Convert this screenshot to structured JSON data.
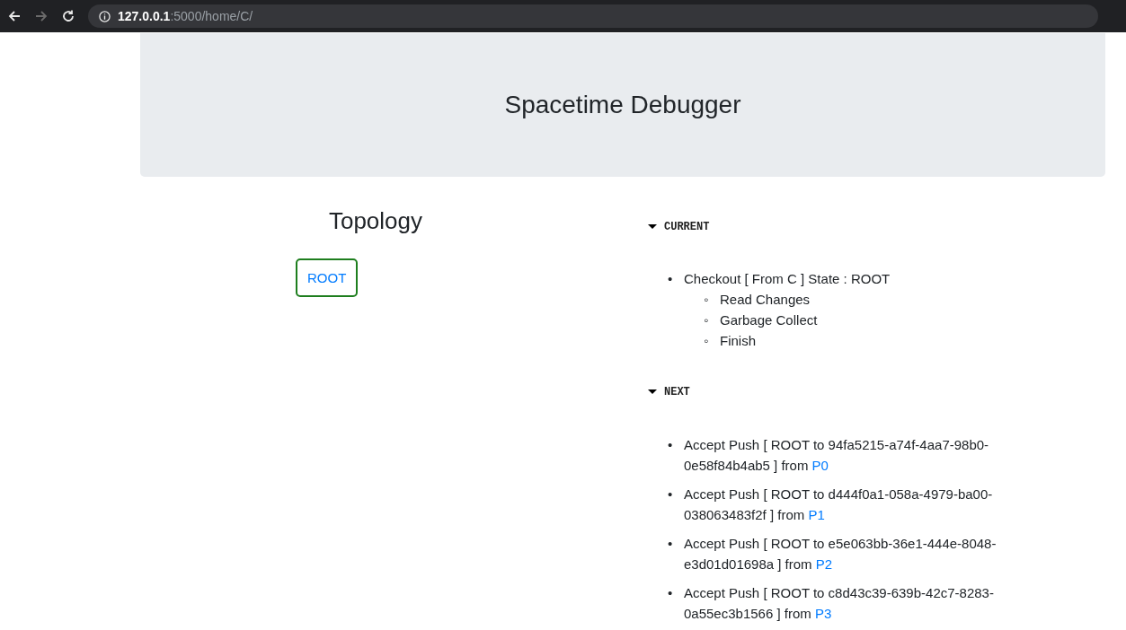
{
  "browser": {
    "nav_buttons": [
      {
        "kind": "back",
        "disabled": false
      },
      {
        "kind": "forward",
        "disabled": true
      },
      {
        "kind": "reload",
        "disabled": false
      }
    ],
    "url_host": "127.0.0.1",
    "url_path": ":5000/home/C/"
  },
  "header": {
    "title": "Spacetime Debugger"
  },
  "topology": {
    "title": "Topology",
    "nodes": [
      {
        "label": "ROOT"
      }
    ]
  },
  "sections": [
    {
      "title": "CURRENT",
      "expanded": true,
      "items": [
        {
          "bullet": "•",
          "text": "Checkout [ From C ] State : ROOT",
          "children": [
            {
              "bullet": "◦",
              "text": "Read Changes"
            },
            {
              "bullet": "◦",
              "text": "Garbage Collect"
            },
            {
              "bullet": "◦",
              "text": "Finish"
            }
          ]
        }
      ]
    },
    {
      "title": "NEXT",
      "expanded": true,
      "items": [
        {
          "bullet": "•",
          "text": "Accept Push [ ROOT to 94fa5215-a74f-4aa7-98b0-0e58f84b4ab5 ] from",
          "link": "P0"
        },
        {
          "bullet": "•",
          "text": "Accept Push [ ROOT to d444f0a1-058a-4979-ba00-038063483f2f ] from",
          "link": "P1"
        },
        {
          "bullet": "•",
          "text": "Accept Push [ ROOT to e5e063bb-36e1-444e-8048-e3d01d01698a ] from",
          "link": "P2"
        },
        {
          "bullet": "•",
          "text": "Accept Push [ ROOT to c8d43c39-639b-42c7-8283-0a55ec3b1566 ] from",
          "link": "P3"
        }
      ]
    }
  ]
}
